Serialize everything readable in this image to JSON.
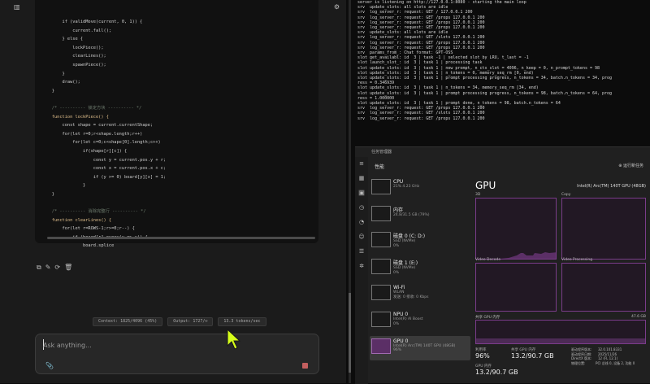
{
  "chat": {
    "icons": [
      "sidebar-icon",
      "settings-icon"
    ],
    "code_lines": [
      {
        "t": "        if (validMove(current, 0, 1)) {",
        "c": ""
      },
      {
        "t": "            current.fall();",
        "c": ""
      },
      {
        "t": "        } else {",
        "c": ""
      },
      {
        "t": "            lockPiece();",
        "c": ""
      },
      {
        "t": "            clearLines();",
        "c": ""
      },
      {
        "t": "            spawnPiece();",
        "c": ""
      },
      {
        "t": "        }",
        "c": ""
      },
      {
        "t": "        draw();",
        "c": ""
      },
      {
        "t": "    }",
        "c": ""
      },
      {
        "t": "",
        "c": ""
      },
      {
        "t": "    /* ---------- 锁定方块 ---------- */",
        "c": "cm"
      },
      {
        "t": "    function lockPiece() {",
        "c": "fn"
      },
      {
        "t": "        const shape = current.currentShape;",
        "c": ""
      },
      {
        "t": "        for(let r=0;r<shape.length;r++)",
        "c": ""
      },
      {
        "t": "            for(let c=0;c<shape[0].length;c++)",
        "c": ""
      },
      {
        "t": "                if(shape[r][c]) {",
        "c": ""
      },
      {
        "t": "                    const y = current.pos.y + r;",
        "c": ""
      },
      {
        "t": "                    const x = current.pos.x + c;",
        "c": ""
      },
      {
        "t": "                    if (y >= 0) board[y][x] = 1;",
        "c": ""
      },
      {
        "t": "                }",
        "c": ""
      },
      {
        "t": "    }",
        "c": ""
      },
      {
        "t": "",
        "c": ""
      },
      {
        "t": "    /* ---------- 消除完整行 ---------- */",
        "c": "cm"
      },
      {
        "t": "    function clearLines() {",
        "c": "fn"
      },
      {
        "t": "        for(let r=ROWS-1;r>=0;r--) {",
        "c": ""
      },
      {
        "t": "            if (board[r].every(v => v)) {",
        "c": ""
      },
      {
        "t": "                board.splice",
        "c": ""
      }
    ],
    "message_actions": [
      "copy-icon",
      "edit-icon",
      "regenerate-icon",
      "delete-icon"
    ],
    "stats": {
      "context": "Context: 1825/4096 (45%)",
      "output": "Output: 1727/∞",
      "speed": "13.3 tokens/sec"
    },
    "input": {
      "placeholder": "Ask anything..."
    }
  },
  "terminal": {
    "lines": [
      "server is listening on http://127.0.0.1:8080 - starting the main loop",
      "srv  update_slots: all slots are idle",
      "srv  log_server_r: request: GET / 127.0.0.1 200",
      "srv  log_server_r: request: GET /props 127.0.0.1 200",
      "srv  log_server_r: request: GET /props 127.0.0.1 200",
      "srv  log_server_r: request: GET /props 127.0.0.1 200",
      "srv  update_slots: all slots are idle",
      "srv  log_server_r: request: GET /slots 127.0.0.1 200",
      "srv  log_server_r: request: GET /props 127.0.0.1 200",
      "srv  log_server_r: request: GET /props 127.0.0.1 200",
      "srv  params_from_: Chat format: GPT-OSS",
      "slot get_availabl: id  3 | task -1 | selected slot by LRU, t_last = -1",
      "slot launch_slot_: id  3 | task 1 | processing task",
      "slot update_slots: id  3 | task 1 | new prompt, n_ctx_slot = 4096, n_keep = 0, n_prompt_tokens = 98",
      "slot update_slots: id  3 | task 1 | n_tokens = 0, memory_seq_rm [0, end)",
      "slot update_slots: id  3 | task 1 | prompt processing progress, n_tokens = 34, batch.n_tokens = 34, prog",
      "ress = 0.346939",
      "slot update_slots: id  3 | task 1 | n_tokens = 34, memory_seq_rm [34, end)",
      "slot update_slots: id  3 | task 1 | prompt processing progress, n_tokens = 98, batch.n_tokens = 64, prog",
      "ress = 1.000000",
      "slot update_slots: id  3 | task 1 | prompt done, n_tokens = 98, batch.n_tokens = 64",
      "srv  log_server_r: request: GET /props 127.0.0.1 200",
      "srv  log_server_r: request: GET /slots 127.0.0.1 200",
      "srv  log_server_r: request: GET /props 127.0.0.1 200"
    ]
  },
  "taskmgr": {
    "window_title": "任务管理器",
    "page_title": "性能",
    "run_task": "运行新任务",
    "resources": [
      {
        "name": "CPU",
        "sub": [
          "21% 4.23 GHz"
        ],
        "selected": false
      },
      {
        "name": "内存",
        "sub": [
          "24.8/31.5 GB (79%)"
        ],
        "selected": false
      },
      {
        "name": "磁盘 0 (C: D:)",
        "sub": [
          "SSD (NVMe)",
          "0%"
        ],
        "selected": false
      },
      {
        "name": "磁盘 1 (E:)",
        "sub": [
          "SSD (NVMe)",
          "0%"
        ],
        "selected": false
      },
      {
        "name": "Wi-Fi",
        "sub": [
          "WLAN",
          "发送: 0 接收: 0 Kbps"
        ],
        "selected": false
      },
      {
        "name": "NPU 0",
        "sub": [
          "Intel(R) AI Boost",
          "0%"
        ],
        "selected": false
      },
      {
        "name": "GPU 0",
        "sub": [
          "Intel(R) Arc(TM) 140T GPU (48GB)",
          "96%"
        ],
        "selected": true
      }
    ],
    "gpu": {
      "title": "GPU",
      "device": "Intel(R) Arc(TM) 140T GPU (48GB)",
      "graphs": {
        "3d": "3D",
        "copy": "Copy",
        "video_decode": "Video Decode",
        "video_processing": "Video Processing"
      },
      "shared_mem_label": "共享 GPU 内存",
      "shared_mem_max": "47.6 GB",
      "utilization_label": "利用率",
      "utilization": "96%",
      "shared_mem_use_label": "共享 GPU 内存",
      "shared_mem_use": "13.2/90.7 GB",
      "gpu_mem_label": "GPU 内存",
      "gpu_mem": "13.2/90.7 GB",
      "meta": "驱动程序版本:      32.0.101.8331\n驱动程序日期:      2025/11/26\nDirectX 版本:      12 (FL 12.1)\n物理位置:          PCI 总线 0, 设备 2, 功能 0"
    }
  }
}
